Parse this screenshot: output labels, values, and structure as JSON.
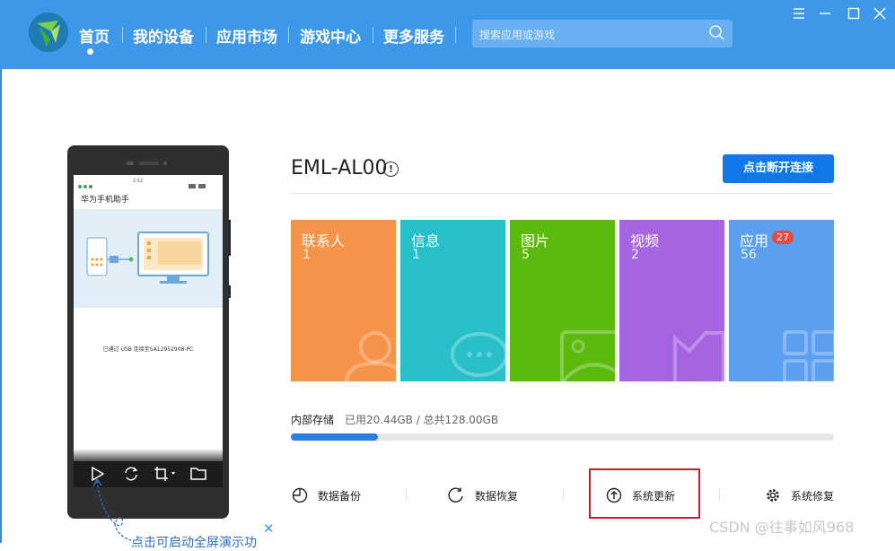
{
  "nav": {
    "items": [
      "首页",
      "我的设备",
      "应用市场",
      "游戏中心",
      "更多服务"
    ],
    "active_index": 0
  },
  "search": {
    "placeholder": "搜索应用或游戏"
  },
  "window_controls": [
    "menu-icon",
    "minimize-icon",
    "maximize-icon",
    "close-icon"
  ],
  "phone": {
    "app_title": "华为手机助手",
    "status_time": "2:52",
    "connection_message": "已通过 USB 连接至SA12952908-PC",
    "toolbar_icons": [
      "play-icon",
      "refresh-icon",
      "crop-icon",
      "folder-icon"
    ],
    "hint": "点击可启动全屏演示功"
  },
  "device": {
    "name": "EML-AL00",
    "disconnect_label": "点击断开连接"
  },
  "tiles": [
    {
      "label": "联系人",
      "count": "1",
      "color": "#f6934b",
      "icon": "contact-icon"
    },
    {
      "label": "信息",
      "count": "1",
      "color": "#27bfc8",
      "icon": "message-icon"
    },
    {
      "label": "图片",
      "count": "5",
      "color": "#5cb90e",
      "icon": "picture-icon"
    },
    {
      "label": "视频",
      "count": "2",
      "color": "#a664e1",
      "icon": "video-icon"
    },
    {
      "label": "应用",
      "count": "56",
      "badge": "27",
      "color": "#5b9ff0",
      "icon": "apps-icon"
    }
  ],
  "storage": {
    "title": "内部存储",
    "usage_text": "已用20.44GB / 总共128.00GB",
    "used_fraction": 0.16
  },
  "actions": [
    {
      "label": "数据备份",
      "icon": "backup-icon"
    },
    {
      "label": "数据恢复",
      "icon": "restore-icon"
    },
    {
      "label": "系统更新",
      "icon": "update-icon"
    },
    {
      "label": "系统修复",
      "icon": "repair-icon"
    }
  ],
  "watermark": "CSDN @往事如风968",
  "colors": {
    "header": "#3d98ea",
    "accent": "#1078e8",
    "highlight": "#c81e2a"
  }
}
